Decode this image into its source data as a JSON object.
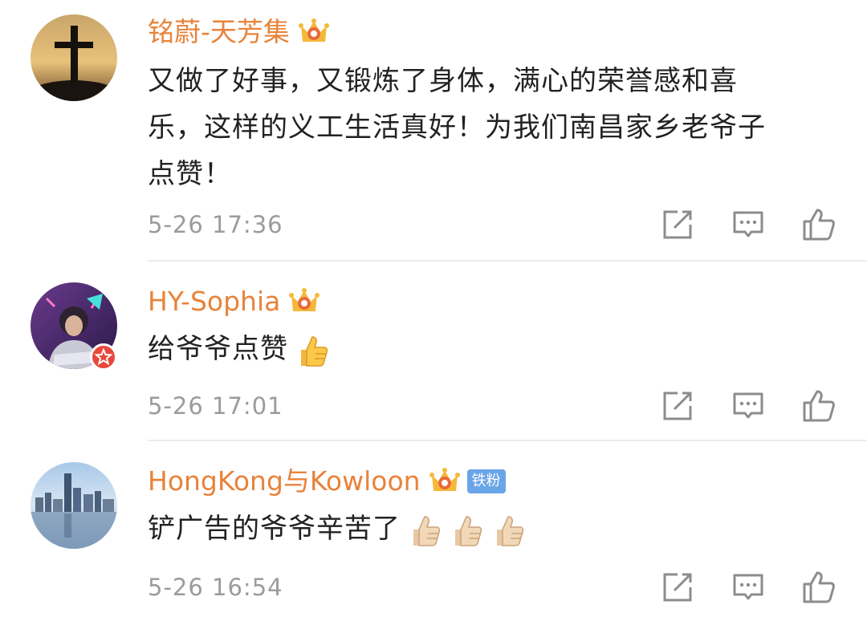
{
  "comments": [
    {
      "username": "铭蔚-天芳集",
      "text_lines": [
        "又做了好事，又锻炼了身体，满心的荣誉感和喜",
        "乐，这样的义工生活真好！为我们南昌家乡老爷子",
        "点赞！"
      ],
      "time": "5-26 17:36",
      "avatar_icon": "cross-sunset-avatar",
      "verified": false,
      "fan_badge": ""
    },
    {
      "username": "HY-Sophia",
      "text_lines": [
        "给爷爷点赞"
      ],
      "time": "5-26 17:01",
      "avatar_icon": "girl-avatar",
      "verified": true,
      "fan_badge": "",
      "emoji_count": 1
    },
    {
      "username": "HongKong与Kowloon",
      "text_lines": [
        "铲广告的爷爷辛苦了"
      ],
      "time": "5-26 16:54",
      "avatar_icon": "city-skyline-avatar",
      "verified": false,
      "fan_badge": "铁粉",
      "emoji_count": 3
    }
  ],
  "icons": {
    "crown": "crown-badge-icon",
    "repost": "repost-icon",
    "reply": "comment-icon",
    "like": "like-icon",
    "emoji": "thumbs-up-emoji"
  },
  "colors": {
    "username": "#e8833a",
    "timestamp": "#9b9b9b",
    "fan_badge": "#6aa5e8",
    "verified_badge": "#e8483c"
  }
}
